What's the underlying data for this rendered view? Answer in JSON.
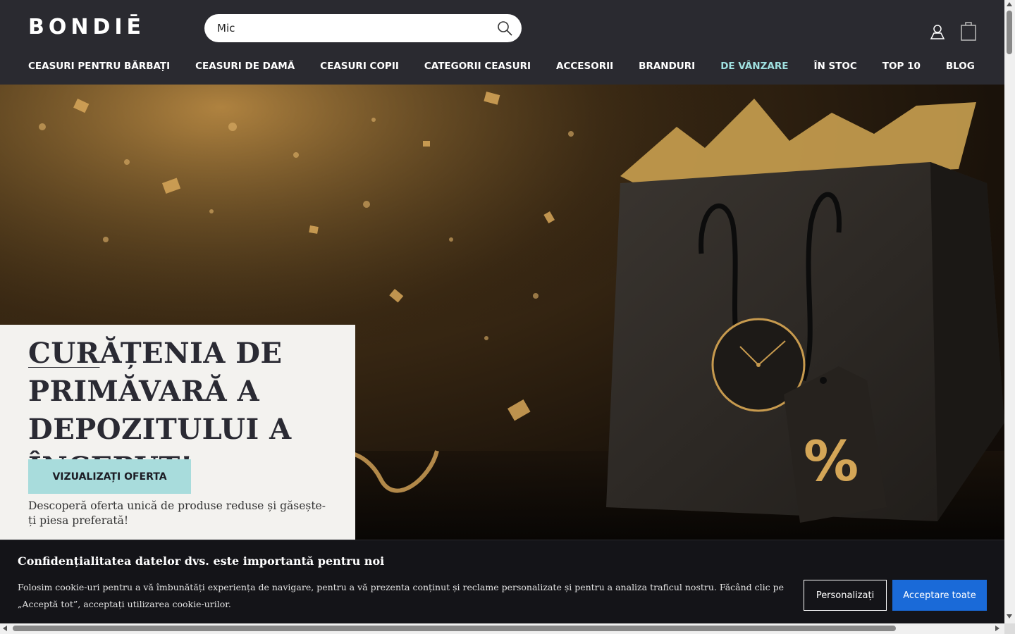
{
  "header": {
    "logo_text": "BONDIĒ",
    "search": {
      "value": "Mic",
      "placeholder": ""
    },
    "icons": {
      "search": "search-icon",
      "user": "user-icon",
      "cart": "shopping-bag-icon"
    }
  },
  "nav": {
    "items": [
      {
        "label": "CEASURI PENTRU BĂRBAȚI"
      },
      {
        "label": "CEASURI DE DAMĂ"
      },
      {
        "label": "CEASURI COPII"
      },
      {
        "label": "CATEGORII CEASURI"
      },
      {
        "label": "ACCESORII"
      },
      {
        "label": "BRANDURI"
      },
      {
        "label": "DE VÂNZARE"
      },
      {
        "label": "ÎN STOC"
      },
      {
        "label": "TOP 10"
      },
      {
        "label": "BLOG"
      }
    ],
    "accent_color": "#9fe0e0"
  },
  "hero": {
    "title_underlined": "CUR",
    "title_rest": "ĂȚENIA DE PRIMĂVARĂ A DEPOZITULUI A ÎNCEPUT!",
    "subtitle": "Descoperă oferta unică de produse reduse și găsește-ți piesa preferată!",
    "cta_label": "VIZUALIZAȚI OFERTA",
    "tag_symbol": "%"
  },
  "cookie_banner": {
    "title": "Confidențialitatea datelor dvs. este importantă pentru noi",
    "text": "Folosim cookie-uri pentru a vă îmbunătăți experiența de navigare, pentru a vă prezenta conținut și reclame personalizate și pentru a analiza traficul nostru. Făcând clic pe „Acceptă tot”, acceptați utilizarea cookie-urilor.",
    "customize_label": "Personalizați",
    "accept_label": "Acceptare toate",
    "accept_color": "#1a6ad8"
  }
}
